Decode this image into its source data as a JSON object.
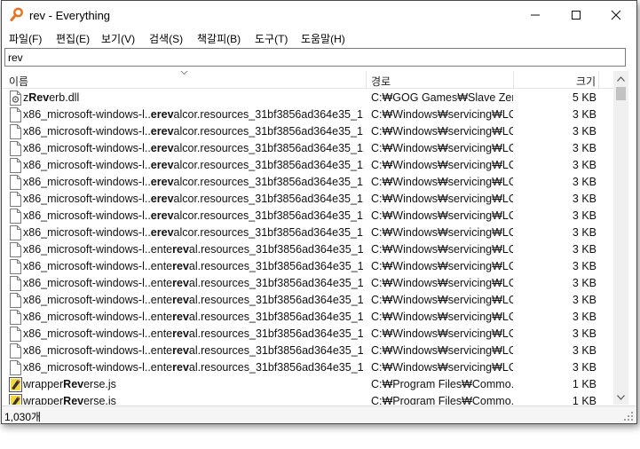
{
  "window": {
    "title": "rev - Everything"
  },
  "menu": [
    {
      "label": "파일(F)"
    },
    {
      "label": "편집(E)"
    },
    {
      "label": "보기(V)"
    },
    {
      "label": "검색(S)"
    },
    {
      "label": "책갈피(B)"
    },
    {
      "label": "도구(T)"
    },
    {
      "label": "도움말(H)"
    }
  ],
  "search": {
    "value": "rev"
  },
  "columns": {
    "name": "이름",
    "path": "경로",
    "size": "크기"
  },
  "rows": [
    {
      "icon": "dll-file-icon",
      "pre": "z",
      "match": "Rev",
      "post": "erb.dll",
      "path": "C:₩GOG Games₩Slave Zero...",
      "size": "5 KB"
    },
    {
      "icon": "file-icon",
      "pre": "x86_microsoft-windows-l..",
      "match": "erev",
      "post": "alcor.resources_31bf3856ad364e35_1...",
      "path": "C:₩Windows₩servicing₩LC...",
      "size": "3 KB"
    },
    {
      "icon": "file-icon",
      "pre": "x86_microsoft-windows-l..",
      "match": "erev",
      "post": "alcor.resources_31bf3856ad364e35_1...",
      "path": "C:₩Windows₩servicing₩LC...",
      "size": "3 KB"
    },
    {
      "icon": "file-icon",
      "pre": "x86_microsoft-windows-l..",
      "match": "erev",
      "post": "alcor.resources_31bf3856ad364e35_1...",
      "path": "C:₩Windows₩servicing₩LC...",
      "size": "3 KB"
    },
    {
      "icon": "file-icon",
      "pre": "x86_microsoft-windows-l..",
      "match": "erev",
      "post": "alcor.resources_31bf3856ad364e35_1...",
      "path": "C:₩Windows₩servicing₩LC...",
      "size": "3 KB"
    },
    {
      "icon": "file-icon",
      "pre": "x86_microsoft-windows-l..",
      "match": "erev",
      "post": "alcor.resources_31bf3856ad364e35_1...",
      "path": "C:₩Windows₩servicing₩LC...",
      "size": "3 KB"
    },
    {
      "icon": "file-icon",
      "pre": "x86_microsoft-windows-l..",
      "match": "erev",
      "post": "alcor.resources_31bf3856ad364e35_1...",
      "path": "C:₩Windows₩servicing₩LC...",
      "size": "3 KB"
    },
    {
      "icon": "file-icon",
      "pre": "x86_microsoft-windows-l..",
      "match": "erev",
      "post": "alcor.resources_31bf3856ad364e35_1...",
      "path": "C:₩Windows₩servicing₩LC...",
      "size": "3 KB"
    },
    {
      "icon": "file-icon",
      "pre": "x86_microsoft-windows-l..",
      "match": "erev",
      "post": "alcor.resources_31bf3856ad364e35_1...",
      "path": "C:₩Windows₩servicing₩LC...",
      "size": "3 KB"
    },
    {
      "icon": "file-icon",
      "pre": "x86_microsoft-windows-l..ente",
      "match": "rev",
      "post": "al.resources_31bf3856ad364e35_1...",
      "path": "C:₩Windows₩servicing₩LC...",
      "size": "3 KB"
    },
    {
      "icon": "file-icon",
      "pre": "x86_microsoft-windows-l..ente",
      "match": "rev",
      "post": "al.resources_31bf3856ad364e35_1...",
      "path": "C:₩Windows₩servicing₩LC...",
      "size": "3 KB"
    },
    {
      "icon": "file-icon",
      "pre": "x86_microsoft-windows-l..ente",
      "match": "rev",
      "post": "al.resources_31bf3856ad364e35_1...",
      "path": "C:₩Windows₩servicing₩LC...",
      "size": "3 KB"
    },
    {
      "icon": "file-icon",
      "pre": "x86_microsoft-windows-l..ente",
      "match": "rev",
      "post": "al.resources_31bf3856ad364e35_1...",
      "path": "C:₩Windows₩servicing₩LC...",
      "size": "3 KB"
    },
    {
      "icon": "file-icon",
      "pre": "x86_microsoft-windows-l..ente",
      "match": "rev",
      "post": "al.resources_31bf3856ad364e35_1...",
      "path": "C:₩Windows₩servicing₩LC...",
      "size": "3 KB"
    },
    {
      "icon": "file-icon",
      "pre": "x86_microsoft-windows-l..ente",
      "match": "rev",
      "post": "al.resources_31bf3856ad364e35_1...",
      "path": "C:₩Windows₩servicing₩LC...",
      "size": "3 KB"
    },
    {
      "icon": "file-icon",
      "pre": "x86_microsoft-windows-l..ente",
      "match": "rev",
      "post": "al.resources_31bf3856ad364e35_1...",
      "path": "C:₩Windows₩servicing₩LC...",
      "size": "3 KB"
    },
    {
      "icon": "file-icon",
      "pre": "x86_microsoft-windows-l..ente",
      "match": "rev",
      "post": "al.resources_31bf3856ad364e35_1...",
      "path": "C:₩Windows₩servicing₩LC...",
      "size": "3 KB"
    },
    {
      "icon": "js-file-icon",
      "pre": "wrapper",
      "match": "Rev",
      "post": "erse.js",
      "path": "C:₩Program Files₩Commo...",
      "size": "1 KB"
    },
    {
      "icon": "js-file-icon",
      "pre": "wrapper",
      "match": "Rev",
      "post": "erse.js",
      "path": "C:₩Program Files₩Commo...",
      "size": "1 KB"
    }
  ],
  "status": {
    "count": "1,030개"
  },
  "colors": {
    "app_icon": "#e8731c",
    "scrollbar_track": "#f0f0f0",
    "scrollbar_thumb": "#c2c2c2"
  }
}
